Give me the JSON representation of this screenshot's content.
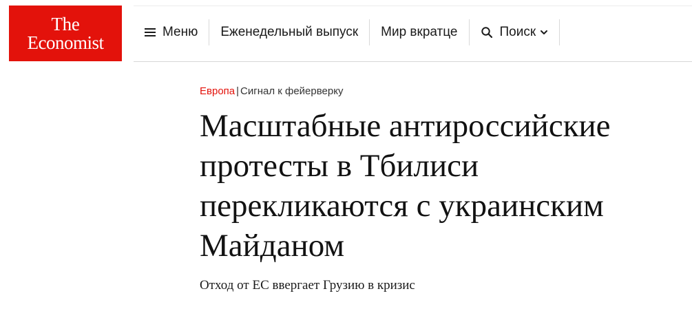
{
  "logo": {
    "line1": "The",
    "line2": "Economist",
    "brand_color": "#e3120b"
  },
  "nav": {
    "menu": {
      "label": "Меню",
      "icon": "menu-icon"
    },
    "weekly": {
      "label": "Еженедельный выпуск"
    },
    "brief": {
      "label": "Мир вкратце"
    },
    "search": {
      "label": "Поиск",
      "icon": "search-icon",
      "caret": "chevron-down-icon"
    }
  },
  "article": {
    "section": "Европа",
    "separator": "|",
    "flytitle": "Сигнал к фейерверку",
    "headline": "Масштабные антироссийские протесты в Тбилиси перекликаются с украинским Майданом",
    "subheadline": "Отход от ЕС ввергает Грузию в кризис"
  }
}
